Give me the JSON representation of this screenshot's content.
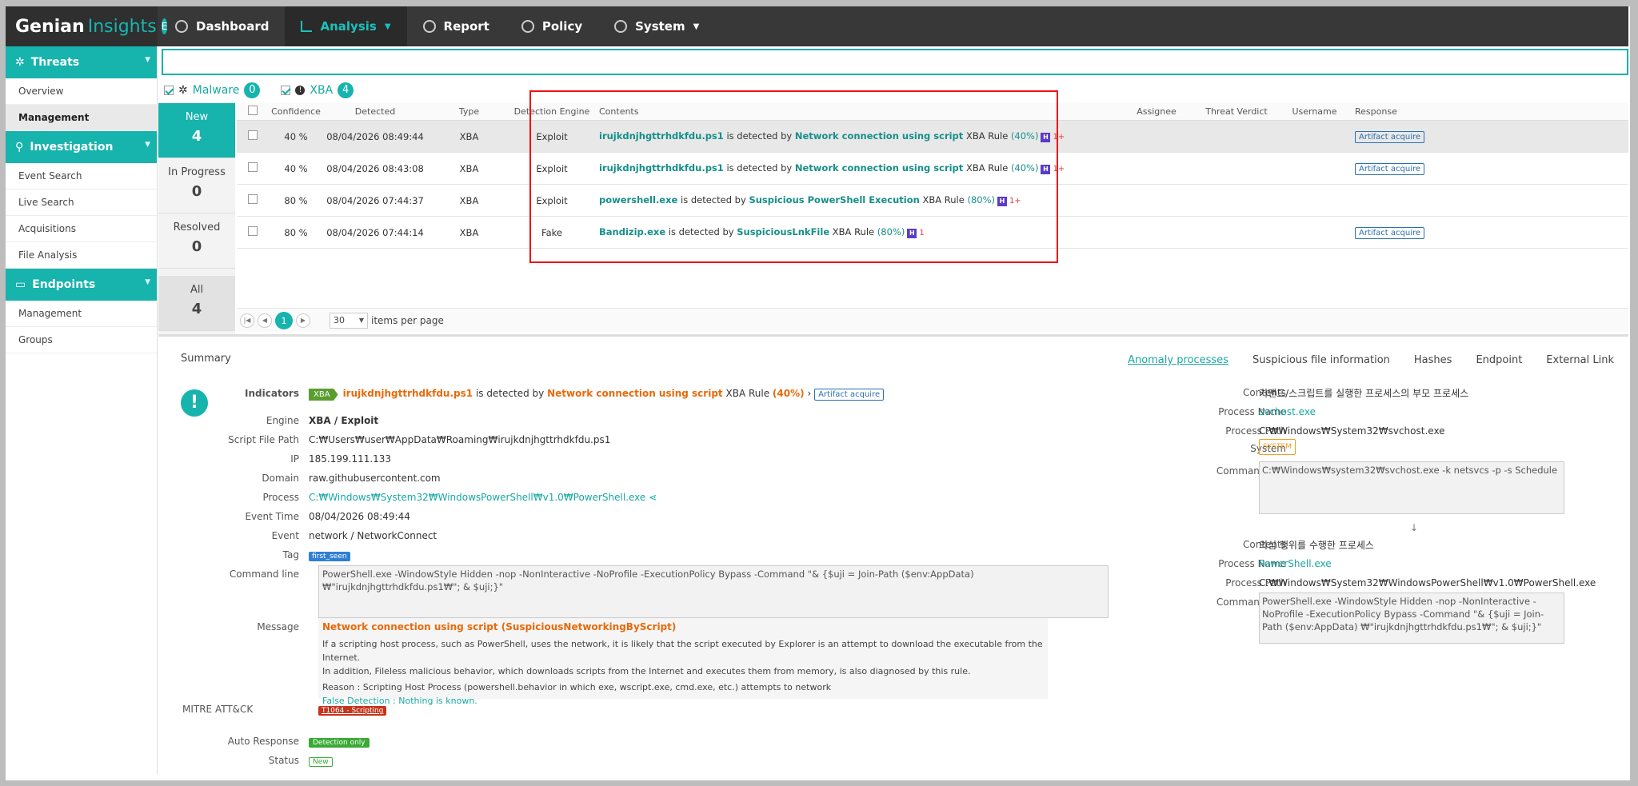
{
  "app": {
    "brand_a": "Genian",
    "brand_b": "Insights",
    "brand_badge": "E"
  },
  "nav": [
    {
      "label": "Dashboard",
      "icon": "dashboard-icon"
    },
    {
      "label": "Analysis",
      "icon": "chart-icon",
      "active": true
    },
    {
      "label": "Report",
      "icon": "report-icon"
    },
    {
      "label": "Policy",
      "icon": "policy-icon"
    },
    {
      "label": "System",
      "icon": "gear-icon"
    }
  ],
  "sidebar": {
    "threats": {
      "label": "Threats",
      "items": [
        "Overview",
        "Management"
      ]
    },
    "investigation": {
      "label": "Investigation",
      "items": [
        "Event Search",
        "Live Search",
        "Acquisitions",
        "File Analysis"
      ]
    },
    "endpoints": {
      "label": "Endpoints",
      "items": [
        "Management",
        "Groups"
      ]
    }
  },
  "filters": {
    "malware_label": "Malware",
    "malware_count": "0",
    "xba_label": "XBA",
    "xba_count": "4"
  },
  "status": {
    "new": {
      "label": "New",
      "count": "4"
    },
    "in_progress": {
      "label": "In Progress",
      "count": "0"
    },
    "resolved": {
      "label": "Resolved",
      "count": "0"
    },
    "all": {
      "label": "All",
      "count": "4"
    }
  },
  "grid": {
    "headers": [
      "Confidence",
      "Detected",
      "Type",
      "Detection Engine",
      "Contents",
      "Assignee",
      "Threat Verdict",
      "Username",
      "Response"
    ],
    "rows": [
      {
        "conf": "40 %",
        "detected": "08/04/2026 08:49:44",
        "type": "XBA",
        "engine": "Exploit",
        "file": "irujkdnjhgttrhdkfdu.ps1",
        "mid": "is detected by",
        "rule": "Network connection using script",
        "xba": "XBA Rule",
        "pct": "(40%)",
        "h": "H",
        "cnt": "1+",
        "resp": "Artifact acquire"
      },
      {
        "conf": "40 %",
        "detected": "08/04/2026 08:43:08",
        "type": "XBA",
        "engine": "Exploit",
        "file": "irujkdnjhgttrhdkfdu.ps1",
        "mid": "is detected by",
        "rule": "Network connection using script",
        "xba": "XBA Rule",
        "pct": "(40%)",
        "h": "H",
        "cnt": "1+",
        "resp": "Artifact acquire"
      },
      {
        "conf": "80 %",
        "detected": "08/04/2026 07:44:37",
        "type": "XBA",
        "engine": "Exploit",
        "file": "powershell.exe",
        "mid": "is detected by",
        "rule": "Suspicious PowerShell Execution",
        "xba": "XBA Rule",
        "pct": "(80%)",
        "h": "H",
        "cnt": "1+",
        "resp": ""
      },
      {
        "conf": "80 %",
        "detected": "08/04/2026 07:44:14",
        "type": "XBA",
        "engine": "Fake",
        "file": "Bandizip.exe",
        "mid": "is detected by",
        "rule": "SuspiciousLnkFile",
        "xba": "XBA Rule",
        "pct": "(80%)",
        "h": "H",
        "cnt": "1",
        "resp": "Artifact acquire"
      }
    ]
  },
  "pager": {
    "page": "1",
    "per_page": "30",
    "per_page_label": "items per page"
  },
  "detail": {
    "summary": "Summary",
    "tabs": [
      "Anomaly processes",
      "Suspicious file information",
      "Hashes",
      "Endpoint",
      "External Link"
    ],
    "indicators_label": "Indicators",
    "ind_badge": "XBA",
    "ind_file": "irujkdnjhgttrhdkfdu.ps1",
    "ind_mid": "is detected by",
    "ind_rule": "Network connection using script",
    "ind_xba": "XBA Rule",
    "ind_pct": "(40%)",
    "ind_btn": "Artifact acquire",
    "engine_k": "Engine",
    "engine_v": "XBA / Exploit",
    "path_k": "Script File Path",
    "path_v": "C:₩Users₩user₩AppData₩Roaming₩irujkdnjhgttrhdkfdu.ps1",
    "ip_k": "IP",
    "ip_v": "185.199.111.133",
    "domain_k": "Domain",
    "domain_v": "raw.githubusercontent.com",
    "process_k": "Process",
    "process_v": "C:₩Windows₩System32₩WindowsPowerShell₩v1.0₩PowerShell.exe",
    "time_k": "Event Time",
    "time_v": "08/04/2026 08:49:44",
    "event_k": "Event",
    "event_v": "network / NetworkConnect",
    "tag_k": "Tag",
    "tag_v": "first_seen",
    "cmd_k": "Command line",
    "cmd_v": "PowerShell.exe -WindowStyle Hidden -nop  -NonInteractive -NoProfile -ExecutionPolicy Bypass -Command \"& {$uji = Join-Path ($env:AppData) ₩\"irujkdnjhgttrhdkfdu.ps1₩\"; & $uji;}\"",
    "msg_k": "Message",
    "msg_title": "Network connection using script (SuspiciousNetworkingByScript)",
    "msg_p1": "If a scripting host process, such as PowerShell, uses the network, it is likely that the script executed by Explorer is an attempt to download the executable from the Internet.",
    "msg_p2": "In addition, Fileless malicious behavior, which downloads scripts from the Internet and executes them from memory, is also diagnosed by this rule.",
    "msg_reason": "Reason : Scripting Host Process (powershell.behavior in which exe, wscript.exe, cmd.exe, etc.) attempts to network",
    "msg_false": "False Detection : Nothing is known.",
    "mitre_k": "MITRE ATT&CK",
    "mitre_v": "T1064 - Scripting",
    "auto_k": "Auto Response",
    "auto_v": "Detection only",
    "status_k": "Status",
    "status_v": "New"
  },
  "right": {
    "contents_k": "Contents",
    "contents1_v": "커맨드/스크립트를 실행한 프로세스의 부모 프로세스",
    "pname_k": "Process Name",
    "pname1_v": "svchost.exe",
    "ppath_k": "Process Path",
    "ppath1_v": "C:₩Windows₩System32₩svchost.exe",
    "system_k": "System",
    "system_v": "SYSTEM",
    "cmd_k": "Command line",
    "cmd1_v": "C:₩Windows₩system32₩svchost.exe -k netsvcs -p -s Schedule",
    "arrow": "↓",
    "contents2_v": "의심 행위를 수행한 프로세스",
    "pname2_v": "PowerShell.exe",
    "ppath2_v": "C:₩Windows₩System32₩WindowsPowerShell₩v1.0₩PowerShell.exe",
    "cmd2_v": "PowerShell.exe -WindowStyle Hidden -nop  -NonInteractive -NoProfile -ExecutionPolicy Bypass -Command \"& {$uji = Join-Path ($env:AppData) ₩\"irujkdnjhgttrhdkfdu.ps1₩\"; & $uji;}\""
  }
}
